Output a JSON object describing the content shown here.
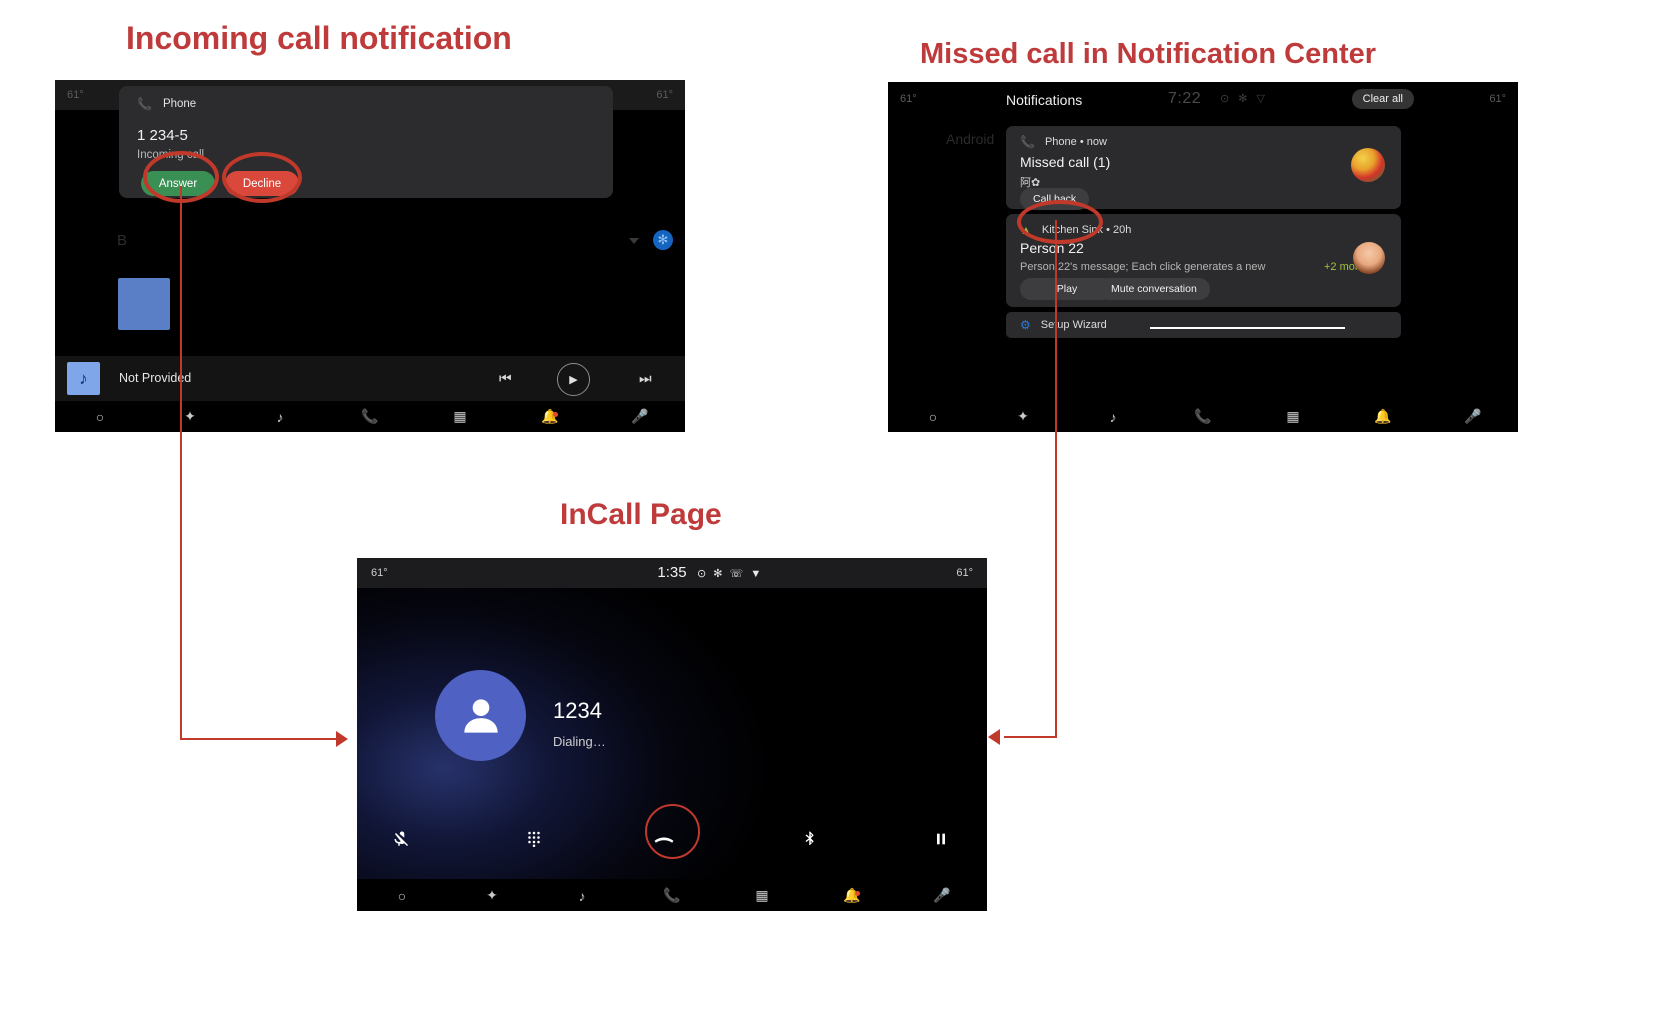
{
  "headings": {
    "incoming": "Incoming call notification",
    "missed": "Missed call in Notification Center",
    "incall": "InCall Page",
    "accent_color": "#bf3b3b"
  },
  "panel_incoming": {
    "status_bar": {
      "temp_left": "61°",
      "temp_right": "61°"
    },
    "background_label": "B",
    "notification": {
      "app_name": "Phone",
      "app_icon": "phone-icon",
      "title": "1 234-5",
      "subtitle": "Incoming call",
      "answer_label": "Answer",
      "decline_label": "Decline",
      "answer_color": "#3a8f55",
      "decline_color": "#d9483b"
    },
    "media_bar": {
      "title": "Not Provided",
      "album_icon": "music-note-icon",
      "prev_icon": "skip-previous-icon",
      "play_icon": "play-icon",
      "next_icon": "skip-next-icon"
    },
    "nav_items": [
      {
        "icon": "home-circle-icon",
        "label": "Home"
      },
      {
        "icon": "navigation-diamond-icon",
        "label": "Navigation"
      },
      {
        "icon": "music-note-icon",
        "label": "Media"
      },
      {
        "icon": "phone-icon",
        "label": "Phone"
      },
      {
        "icon": "apps-grid-icon",
        "label": "Apps"
      },
      {
        "icon": "bell-icon",
        "label": "Notifications"
      },
      {
        "icon": "microphone-icon",
        "label": "Assistant"
      }
    ]
  },
  "panel_notifications": {
    "status_bar": {
      "temp_left": "61°",
      "temp_right": "61°",
      "title": "Notifications",
      "clock": "7:22",
      "system_icons": "⊙ ✻ ▽",
      "clear_all_label": "Clear all"
    },
    "background_label": "Android",
    "cards": [
      {
        "app_name": "Phone • now",
        "app_icon": "phone-icon",
        "title": "Missed call (1)",
        "body": "阿✿",
        "actions": [
          "Call back"
        ],
        "avatar": "contact-avatar-fruit"
      },
      {
        "app_name": "Kitchen Sink • 20h",
        "app_icon": "kitchen-sink-icon",
        "title": "Person 22",
        "body": "Person 22's message; Each click generates a new",
        "more_label": "+2 more",
        "actions": [
          "Play",
          "Mute conversation"
        ],
        "avatar": "contact-avatar-person"
      },
      {
        "app_name": "Setup Wizard",
        "app_icon": "gear-icon",
        "title": "",
        "body": "",
        "actions": []
      }
    ],
    "nav_items": [
      {
        "icon": "home-circle-icon",
        "label": "Home"
      },
      {
        "icon": "navigation-diamond-icon",
        "label": "Navigation"
      },
      {
        "icon": "music-note-icon",
        "label": "Media"
      },
      {
        "icon": "phone-icon",
        "label": "Phone"
      },
      {
        "icon": "apps-grid-icon",
        "label": "Apps"
      },
      {
        "icon": "bell-icon",
        "label": "Notifications"
      },
      {
        "icon": "microphone-icon",
        "label": "Assistant"
      }
    ]
  },
  "panel_incall": {
    "status_bar": {
      "temp_left": "61°",
      "temp_right": "61°",
      "clock": "1:35",
      "system_icons": "⊙ ✻ ☏ ▼"
    },
    "contact": {
      "name": "1234",
      "state": "Dialing…",
      "avatar_icon": "person-avatar-icon",
      "avatar_color": "#5061c4"
    },
    "controls": [
      {
        "icon": "mic-off-icon",
        "label": "Mute"
      },
      {
        "icon": "dialpad-icon",
        "label": "Dialpad"
      },
      {
        "icon": "end-call-icon",
        "label": "End call"
      },
      {
        "icon": "bluetooth-icon",
        "label": "Bluetooth"
      },
      {
        "icon": "pause-icon",
        "label": "Hold"
      }
    ],
    "nav_items": [
      {
        "icon": "home-circle-icon",
        "label": "Home"
      },
      {
        "icon": "navigation-diamond-icon",
        "label": "Navigation"
      },
      {
        "icon": "music-note-icon",
        "label": "Media"
      },
      {
        "icon": "phone-icon",
        "label": "Phone"
      },
      {
        "icon": "apps-grid-icon",
        "label": "Apps"
      },
      {
        "icon": "bell-icon",
        "label": "Notifications"
      },
      {
        "icon": "microphone-icon",
        "label": "Assistant"
      }
    ]
  }
}
